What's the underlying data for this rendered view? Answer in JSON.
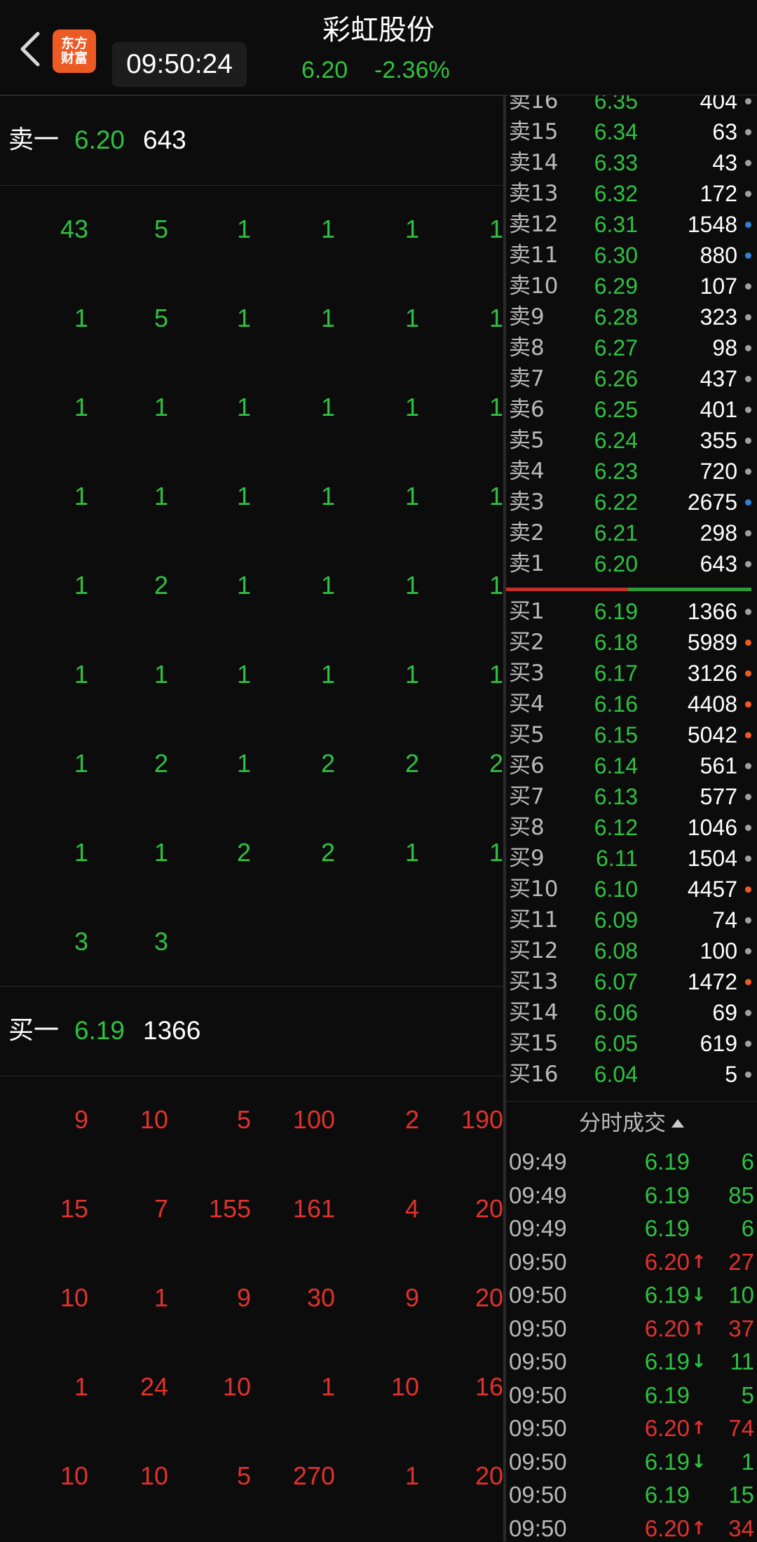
{
  "header": {
    "time": "09:50:24",
    "stock_name": "彩虹股份",
    "price": "6.20",
    "change_pct": "-2.36%",
    "logo_line1": "东方",
    "logo_line2": "财富"
  },
  "colors": {
    "up": "#e0322d",
    "down": "#2fc142",
    "background": "#0c0c0c",
    "logo": "#ee5a24",
    "dot_gray": "#a0a0a0",
    "dot_blue": "#2f7fd6",
    "dot_orange": "#f05a1e"
  },
  "sell_one": {
    "label": "卖一",
    "price": "6.20",
    "volume": "643"
  },
  "sell_queue": [
    [
      "43",
      "5",
      "1",
      "1",
      "1",
      "1"
    ],
    [
      "1",
      "5",
      "1",
      "1",
      "1",
      "1"
    ],
    [
      "1",
      "1",
      "1",
      "1",
      "1",
      "1"
    ],
    [
      "1",
      "1",
      "1",
      "1",
      "1",
      "1"
    ],
    [
      "1",
      "2",
      "1",
      "1",
      "1",
      "1"
    ],
    [
      "1",
      "1",
      "1",
      "1",
      "1",
      "1"
    ],
    [
      "1",
      "2",
      "1",
      "2",
      "2",
      "2"
    ],
    [
      "1",
      "1",
      "2",
      "2",
      "1",
      "1"
    ],
    [
      "3",
      "3"
    ]
  ],
  "buy_one": {
    "label": "买一",
    "price": "6.19",
    "volume": "1366"
  },
  "buy_queue": [
    [
      "9",
      "10",
      "5",
      "100",
      "2",
      "190"
    ],
    [
      "15",
      "7",
      "155",
      "161",
      "4",
      "20"
    ],
    [
      "10",
      "1",
      "9",
      "30",
      "9",
      "20"
    ],
    [
      "1",
      "24",
      "10",
      "1",
      "10",
      "16"
    ],
    [
      "10",
      "10",
      "5",
      "270",
      "1",
      "20"
    ]
  ],
  "order_book": {
    "asks": [
      {
        "label": "卖16",
        "price": "6.35",
        "vol": "404",
        "dot": "gray"
      },
      {
        "label": "卖15",
        "price": "6.34",
        "vol": "63",
        "dot": "gray"
      },
      {
        "label": "卖14",
        "price": "6.33",
        "vol": "43",
        "dot": "gray"
      },
      {
        "label": "卖13",
        "price": "6.32",
        "vol": "172",
        "dot": "gray"
      },
      {
        "label": "卖12",
        "price": "6.31",
        "vol": "1548",
        "dot": "blue"
      },
      {
        "label": "卖11",
        "price": "6.30",
        "vol": "880",
        "dot": "blue"
      },
      {
        "label": "卖10",
        "price": "6.29",
        "vol": "107",
        "dot": "gray"
      },
      {
        "label": "卖9",
        "price": "6.28",
        "vol": "323",
        "dot": "gray"
      },
      {
        "label": "卖8",
        "price": "6.27",
        "vol": "98",
        "dot": "gray"
      },
      {
        "label": "卖7",
        "price": "6.26",
        "vol": "437",
        "dot": "gray"
      },
      {
        "label": "卖6",
        "price": "6.25",
        "vol": "401",
        "dot": "gray"
      },
      {
        "label": "卖5",
        "price": "6.24",
        "vol": "355",
        "dot": "gray"
      },
      {
        "label": "卖4",
        "price": "6.23",
        "vol": "720",
        "dot": "gray"
      },
      {
        "label": "卖3",
        "price": "6.22",
        "vol": "2675",
        "dot": "blue"
      },
      {
        "label": "卖2",
        "price": "6.21",
        "vol": "298",
        "dot": "gray"
      },
      {
        "label": "卖1",
        "price": "6.20",
        "vol": "643",
        "dot": "gray"
      }
    ],
    "bids": [
      {
        "label": "买1",
        "price": "6.19",
        "vol": "1366",
        "dot": "gray"
      },
      {
        "label": "买2",
        "price": "6.18",
        "vol": "5989",
        "dot": "orange"
      },
      {
        "label": "买3",
        "price": "6.17",
        "vol": "3126",
        "dot": "orange"
      },
      {
        "label": "买4",
        "price": "6.16",
        "vol": "4408",
        "dot": "orange"
      },
      {
        "label": "买5",
        "price": "6.15",
        "vol": "5042",
        "dot": "orange"
      },
      {
        "label": "买6",
        "price": "6.14",
        "vol": "561",
        "dot": "gray"
      },
      {
        "label": "买7",
        "price": "6.13",
        "vol": "577",
        "dot": "gray"
      },
      {
        "label": "买8",
        "price": "6.12",
        "vol": "1046",
        "dot": "gray"
      },
      {
        "label": "买9",
        "price": "6.11",
        "vol": "1504",
        "dot": "gray"
      },
      {
        "label": "买10",
        "price": "6.10",
        "vol": "4457",
        "dot": "orange"
      },
      {
        "label": "买11",
        "price": "6.09",
        "vol": "74",
        "dot": "gray"
      },
      {
        "label": "买12",
        "price": "6.08",
        "vol": "100",
        "dot": "gray"
      },
      {
        "label": "买13",
        "price": "6.07",
        "vol": "1472",
        "dot": "orange"
      },
      {
        "label": "买14",
        "price": "6.06",
        "vol": "69",
        "dot": "gray"
      },
      {
        "label": "买15",
        "price": "6.05",
        "vol": "619",
        "dot": "gray"
      },
      {
        "label": "买16",
        "price": "6.04",
        "vol": "5",
        "dot": "gray"
      }
    ],
    "buy_sell_ratio": 0.497
  },
  "trades": {
    "title": "分时成交",
    "rows": [
      {
        "time": "09:49",
        "price": "6.19",
        "dir": "",
        "vol": "6",
        "color": "green"
      },
      {
        "time": "09:49",
        "price": "6.19",
        "dir": "",
        "vol": "85",
        "color": "green"
      },
      {
        "time": "09:49",
        "price": "6.19",
        "dir": "",
        "vol": "6",
        "color": "green"
      },
      {
        "time": "09:50",
        "price": "6.20",
        "dir": "↑",
        "vol": "27",
        "color": "red"
      },
      {
        "time": "09:50",
        "price": "6.19",
        "dir": "↓",
        "vol": "10",
        "color": "green"
      },
      {
        "time": "09:50",
        "price": "6.20",
        "dir": "↑",
        "vol": "37",
        "color": "red"
      },
      {
        "time": "09:50",
        "price": "6.19",
        "dir": "↓",
        "vol": "11",
        "color": "green"
      },
      {
        "time": "09:50",
        "price": "6.19",
        "dir": "",
        "vol": "5",
        "color": "green"
      },
      {
        "time": "09:50",
        "price": "6.20",
        "dir": "↑",
        "vol": "74",
        "color": "red"
      },
      {
        "time": "09:50",
        "price": "6.19",
        "dir": "↓",
        "vol": "1",
        "color": "green"
      },
      {
        "time": "09:50",
        "price": "6.19",
        "dir": "",
        "vol": "15",
        "color": "green"
      },
      {
        "time": "09:50",
        "price": "6.20",
        "dir": "↑",
        "vol": "34",
        "color": "red"
      }
    ]
  }
}
